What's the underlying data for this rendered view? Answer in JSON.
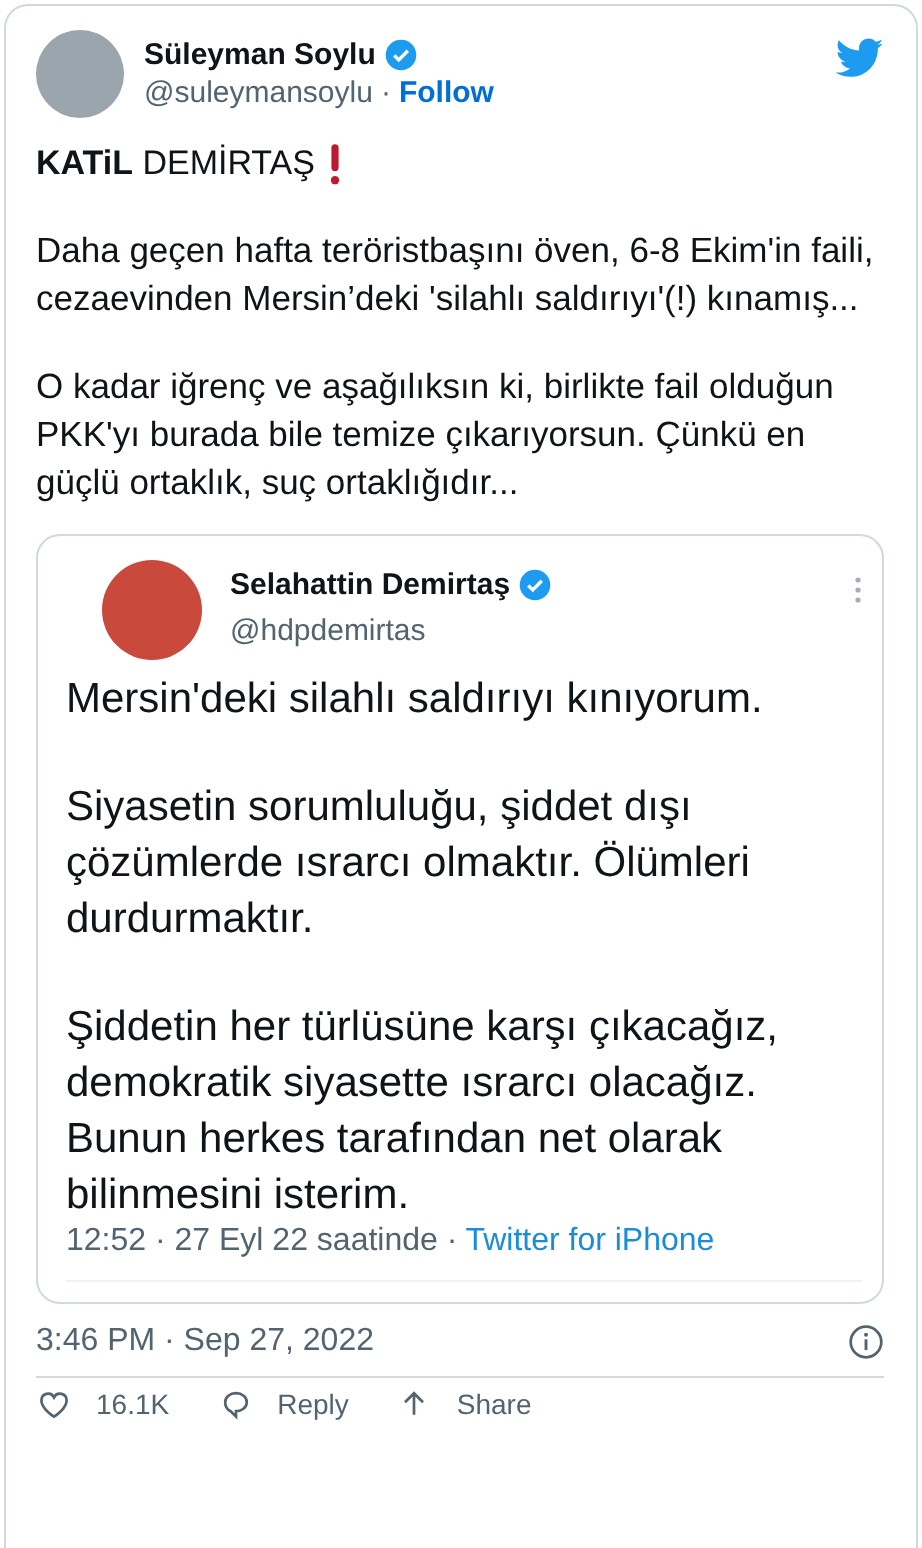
{
  "tweet": {
    "author": {
      "name": "Süleyman Soylu",
      "verified": true,
      "handle": "@suleymansoylu",
      "separator": "·",
      "follow": "Follow"
    },
    "title": "**KATiL** DEMİRTAŞ",
    "paragraphs": [
      "Daha geçen hafta teröristbaşını öven, 6-8 Ekim'in faili, cezaevinden Mersin’deki 'silahlı saldırıyı'(!) kınamış...",
      "O kadar iğrenç ve aşağılıksın ki, birlikte fail olduğun PKK'yı burada bile temize çıkarıyorsun. Çünkü en güçlü ortaklık, suç ortaklığıdır..."
    ],
    "quoted": {
      "author": {
        "name": "Selahattin Demirtaş",
        "verified": true,
        "handle": "@hdpdemirtas"
      },
      "paragraphs": [
        "Mersin'deki silahlı saldırıyı kınıyorum.",
        "Siyasetin sorumluluğu, şiddet dışı çözümlerde ısrarcı olmaktır. Ölümleri durdurmaktır.",
        "Şiddetin her türlüsüne karşı çıkacağız, demokratik siyasette ısrarcı olacağız. Bunun herkes tarafından net olarak bilinmesini isterim."
      ],
      "time": "12:52 · 27 Eyl 22 saatinde ·",
      "source": "Twitter for iPhone"
    },
    "timestamp": "3:46 PM · Sep 27, 2022",
    "actions": [
      {
        "kind": "like",
        "label": "16.1K"
      },
      {
        "kind": "reply",
        "label": "Reply"
      },
      {
        "kind": "share",
        "label": "Share"
      }
    ]
  }
}
